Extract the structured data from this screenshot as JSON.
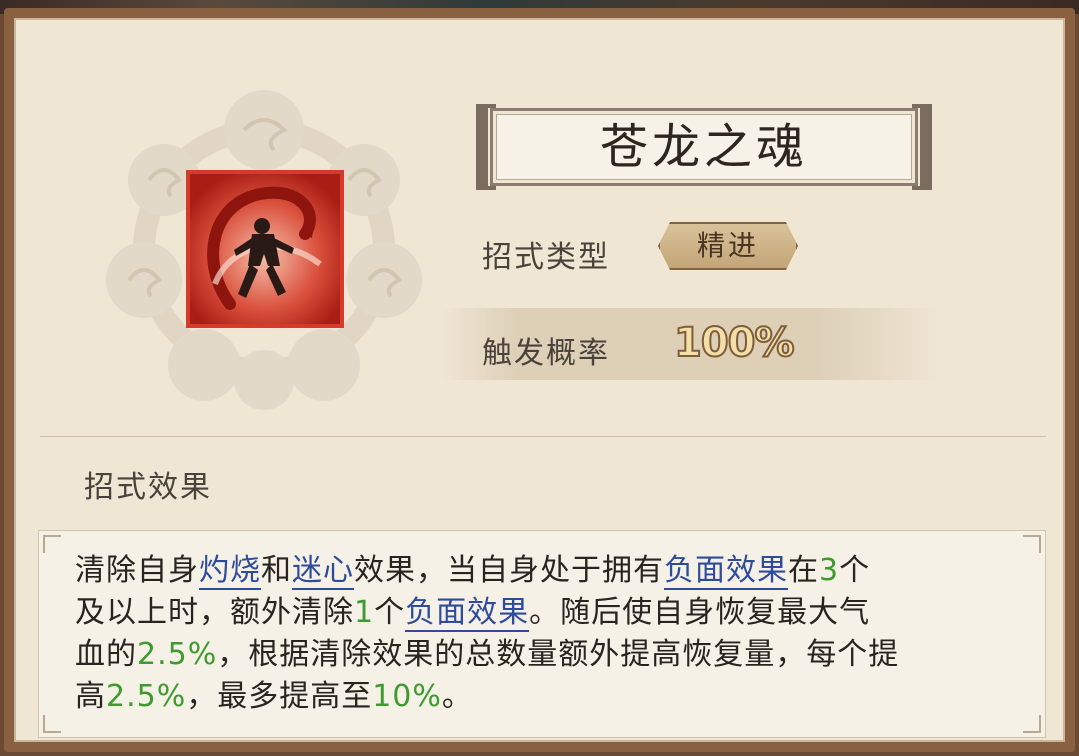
{
  "skill": {
    "name": "苍龙之魂",
    "type_label": "招式类型",
    "type_value": "精进",
    "trigger_label": "触发概率",
    "trigger_value": "100%",
    "effect_section_title": "招式效果"
  },
  "description": {
    "line1": [
      {
        "t": "清除自身",
        "s": "text"
      },
      {
        "t": "灼烧",
        "s": "kw"
      },
      {
        "t": "和",
        "s": "text"
      },
      {
        "t": "迷心",
        "s": "kw"
      },
      {
        "t": "效果，当自身处于拥有",
        "s": "text"
      },
      {
        "t": "负面效果",
        "s": "kw"
      },
      {
        "t": "在",
        "s": "text"
      },
      {
        "t": "3",
        "s": "num"
      },
      {
        "t": "个",
        "s": "text"
      }
    ],
    "line2": [
      {
        "t": "及以上时，额外清除",
        "s": "text"
      },
      {
        "t": "1",
        "s": "num"
      },
      {
        "t": "个",
        "s": "text"
      },
      {
        "t": "负面效果",
        "s": "kw"
      },
      {
        "t": "。随后使自身恢复最大气",
        "s": "text"
      }
    ],
    "line3": [
      {
        "t": "血的",
        "s": "text"
      },
      {
        "t": "2.5%",
        "s": "num"
      },
      {
        "t": "，根据清除效果的总数量额外提高恢复量，每个提",
        "s": "text"
      }
    ],
    "line4": [
      {
        "t": "高",
        "s": "text"
      },
      {
        "t": "2.5%",
        "s": "num"
      },
      {
        "t": "，最多提高至",
        "s": "text"
      },
      {
        "t": "10%",
        "s": "num"
      },
      {
        "t": "。",
        "s": "text"
      }
    ]
  },
  "colors": {
    "keyword": "#2e4b9c",
    "number": "#3e9b2e",
    "panel_bg": "#efe6d4",
    "icon_red": "#c93325"
  },
  "icons": {
    "skill_icon": "dragon-warrior-icon",
    "emblem": "cloud-emblem-icon"
  }
}
